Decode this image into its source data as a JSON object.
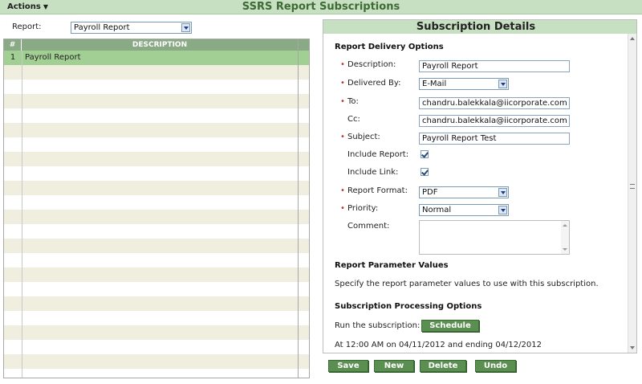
{
  "header": {
    "actions_label": "Actions",
    "title": "SSRS Report Subscriptions"
  },
  "report_filter": {
    "label": "Report:",
    "selected": "Payroll Report"
  },
  "grid": {
    "columns": [
      "#",
      "DESCRIPTION"
    ],
    "rows": [
      {
        "num": "1",
        "description": "Payroll Report"
      }
    ]
  },
  "details": {
    "title": "Subscription Details",
    "delivery_section": "Report Delivery Options",
    "fields": {
      "description": {
        "label": "Description:",
        "value": "Payroll Report"
      },
      "delivered_by": {
        "label": "Delivered By:",
        "value": "E-Mail"
      },
      "to": {
        "label": "To:",
        "value": "chandru.balekkala@iicorporate.com"
      },
      "cc": {
        "label": "Cc:",
        "value": "chandru.balekkala@iicorporate.com"
      },
      "subject": {
        "label": "Subject:",
        "value": "Payroll Report Test"
      },
      "include_report": {
        "label": "Include Report:"
      },
      "include_link": {
        "label": "Include Link:"
      },
      "report_format": {
        "label": "Report Format:",
        "value": "PDF"
      },
      "priority": {
        "label": "Priority:",
        "value": "Normal"
      },
      "comment": {
        "label": "Comment:"
      }
    },
    "parameter_section": "Report Parameter Values",
    "parameter_text": "Specify the report parameter values to use with this subscription.",
    "processing_section": "Subscription Processing Options",
    "run_label": "Run the subscription:",
    "schedule_button": "Schedule",
    "schedule_text": "At 12:00 AM on 04/11/2012 and ending 04/12/2012"
  },
  "buttons": {
    "save": "Save",
    "new": "New",
    "delete": "Delete",
    "undo": "Undo"
  },
  "colors": {
    "header_bg": "#c8e0c2",
    "title_green": "#3d6a35",
    "grid_header": "#8aa985",
    "row_selected": "#a2cf94",
    "row_alt": "#efeedf",
    "button_green": "#5b8f52",
    "required_mark": "#c0392b"
  }
}
